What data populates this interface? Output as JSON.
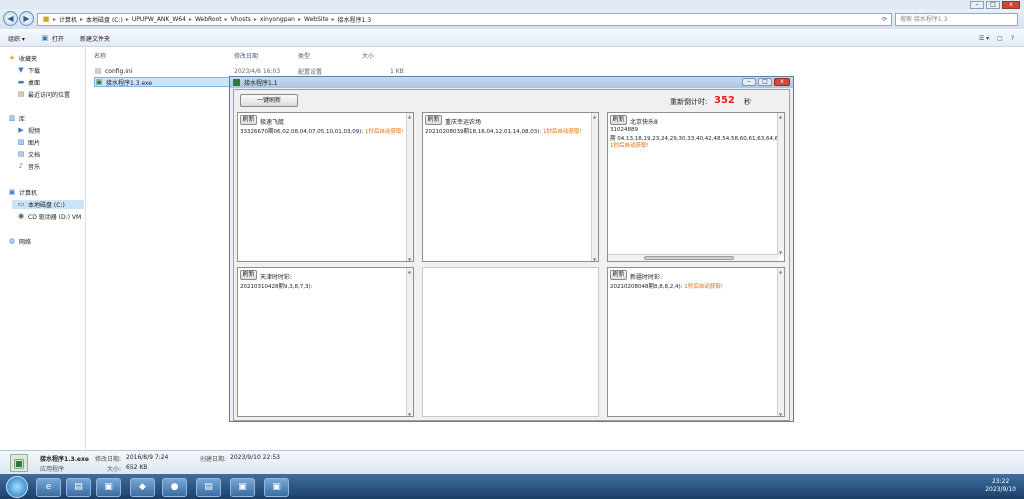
{
  "explorer": {
    "breadcrumb": [
      "计算机",
      "本地磁盘 (C:)",
      "UPUPW_ANK_W64",
      "WebRoot",
      "Vhosts",
      "xinyongpan",
      "WebSite",
      "接水程序1.3"
    ],
    "search_placeholder": "搜索 接水程序1.3",
    "toolbar": {
      "organize": "组织 ▾",
      "open": "打开",
      "new_folder": "新建文件夹"
    },
    "nav": {
      "favorites": "收藏夹",
      "favorites_items": [
        "下载",
        "桌面",
        "最近访问的位置"
      ],
      "libraries": "库",
      "libraries_items": [
        "视频",
        "图片",
        "文档",
        "音乐"
      ],
      "computer": "计算机",
      "computer_items": [
        "本地磁盘 (C:)",
        "CD 驱动器 (D:) VM"
      ],
      "network": "网络"
    },
    "columns": [
      "名称",
      "修改日期",
      "类型",
      "大小"
    ],
    "files": [
      {
        "name": "config.ini",
        "date": "2023/4/6 16:03",
        "type": "配置设置",
        "size": "1 KB"
      },
      {
        "name": "接水程序1.3.exe",
        "date": "",
        "type": "",
        "size": ""
      }
    ],
    "details": {
      "name": "接水程序1.3.exe",
      "kind": "应用程序",
      "modified_label": "修改日期:",
      "modified": "2016/8/9 7:24",
      "size_label": "大小:",
      "size": "652 KB",
      "created_label": "创建日期:",
      "created": "2023/9/10 22:53"
    }
  },
  "taskbar": {
    "time": "23:22",
    "date": "2023/9/10"
  },
  "app": {
    "title": "接水程序1.1",
    "refresh_all": "一键刷新",
    "countdown_label": "重新倒计时:",
    "countdown_value": "352",
    "countdown_unit": "秒",
    "panel_button": "刷新",
    "panels": [
      {
        "name": "极速飞艇",
        "lines": [
          "33326670期06,02,08,04,07,05,10,01,03,09):"
        ],
        "note": "1秒后自动获取!"
      },
      {
        "name": "重庆幸运农场",
        "lines": [
          "20210208039期18,16,04,12,01,14,08,03):"
        ],
        "note": "1秒后自动获取!"
      },
      {
        "name": "北京快乐8",
        "lines": [
          "31024889",
          "期 04,13,18,19,23,24,29,30,33,40,42,48,54,58,60,61,63,64,67,74"
        ],
        "note": "1秒后自动获取!"
      },
      {
        "name": "天津时时彩:",
        "lines": [
          "20210310428期9,3,8,7,3):"
        ],
        "note": ""
      },
      {
        "name": "新疆时时彩:",
        "lines": [
          "20210208048期8,8,8,2,4):"
        ],
        "note": "1秒后自动获取!"
      }
    ]
  },
  "colors": {
    "accent_red": "#e2231a",
    "note_orange": "#e06a00",
    "window_blue": "#a9c4e4"
  }
}
